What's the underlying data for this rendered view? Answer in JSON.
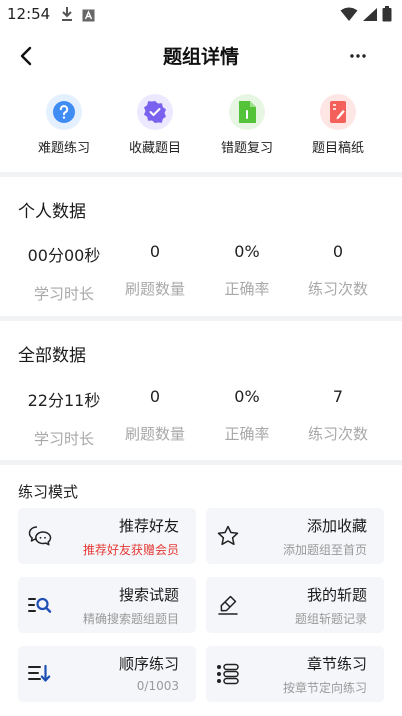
{
  "status_bar": {
    "time": "12:54"
  },
  "nav": {
    "title": "题组详情"
  },
  "quick_actions": [
    {
      "label": "难题练习",
      "icon": "question-icon",
      "color": "#3f8cf5",
      "bg": "#e4efff"
    },
    {
      "label": "收藏题目",
      "icon": "badge-check-icon",
      "color": "#7a61ef",
      "bg": "#ece8ff"
    },
    {
      "label": "错题复习",
      "icon": "document-icon",
      "color": "#55c33a",
      "bg": "#e7f6e2"
    },
    {
      "label": "题目稿纸",
      "icon": "notebook-icon",
      "color": "#f4605a",
      "bg": "#fde6e4"
    }
  ],
  "personal": {
    "title": "个人数据",
    "stats": [
      {
        "value": "00分00秒",
        "label": "学习时长"
      },
      {
        "value": "0",
        "label": "刷题数量"
      },
      {
        "value": "0%",
        "label": "正确率"
      },
      {
        "value": "0",
        "label": "练习次数"
      }
    ]
  },
  "all": {
    "title": "全部数据",
    "stats": [
      {
        "value": "22分11秒",
        "label": "学习时长"
      },
      {
        "value": "0",
        "label": "刷题数量"
      },
      {
        "value": "0%",
        "label": "正确率"
      },
      {
        "value": "7",
        "label": "练习次数"
      }
    ]
  },
  "modes": {
    "title": "练习模式",
    "cards": [
      {
        "title": "推荐好友",
        "sub": "推荐好友获赠会员",
        "icon": "chat-icon"
      },
      {
        "title": "添加收藏",
        "sub": "添加题组至首页",
        "icon": "star-icon"
      },
      {
        "title": "搜索试题",
        "sub": "精确搜索题组题目",
        "icon": "search-list-icon"
      },
      {
        "title": "我的斩题",
        "sub": "题组斩题记录",
        "icon": "eraser-icon"
      },
      {
        "title": "顺序练习",
        "sub": "0/1003",
        "icon": "sort-down-icon"
      },
      {
        "title": "章节练习",
        "sub": "按章节定向练习",
        "icon": "list-icon"
      }
    ]
  }
}
